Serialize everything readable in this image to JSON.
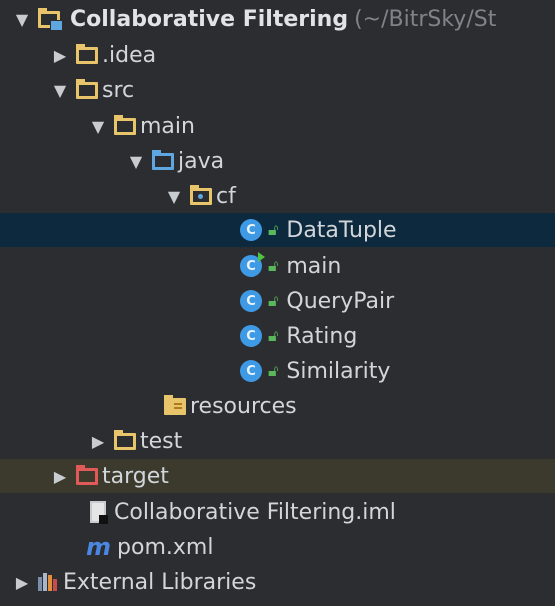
{
  "project": {
    "name": "Collaborative Filtering",
    "path_hint": "(~/BitrSky/St"
  },
  "tree": {
    "idea": ".idea",
    "src": "src",
    "main": "main",
    "java": "java",
    "cf": "cf",
    "classes": [
      "DataTuple",
      "main",
      "QueryPair",
      "Rating",
      "Similarity"
    ],
    "class_letter": "C",
    "resources": "resources",
    "test": "test",
    "target": "target",
    "iml": "Collaborative Filtering.iml",
    "pom": "pom.xml",
    "pom_glyph": "m",
    "external": "External Libraries"
  },
  "colors": {
    "selection": "#0d293e",
    "excluded": "#3b3a2d",
    "folder": "#e8c46a",
    "source_folder": "#5fa7e0",
    "excluded_folder": "#e05a5a",
    "class_icon": "#3f9ae6"
  }
}
